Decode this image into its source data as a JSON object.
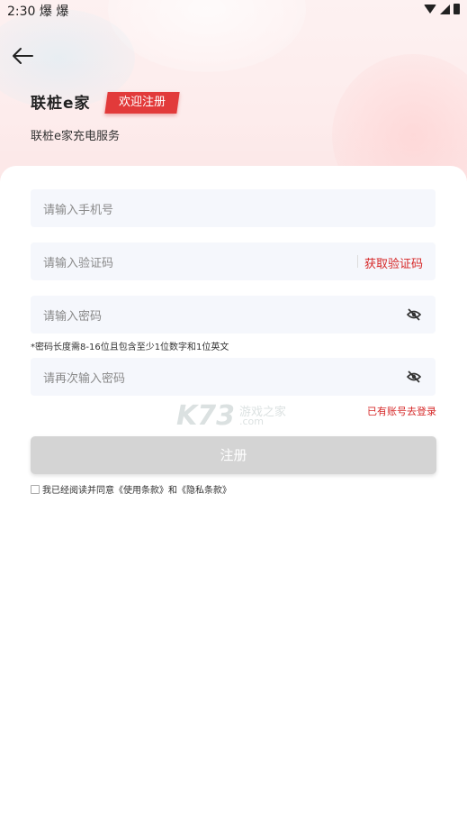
{
  "status_bar": {
    "time": "2:30",
    "extra_icons": "爆 爆"
  },
  "header": {
    "logo": "联桩e家",
    "welcome_badge": "欢迎注册",
    "subtitle": "联桩e家充电服务"
  },
  "form": {
    "phone_placeholder": "请输入手机号",
    "code_placeholder": "请输入验证码",
    "get_code_label": "获取验证码",
    "password_placeholder": "请输入密码",
    "password_hint": "*密码长度需8-16位且包含至少1位数字和1位英文",
    "confirm_password_placeholder": "请再次输入密码",
    "login_link": "已有账号去登录",
    "submit_label": "注册",
    "agreement_text": "我已经阅读并同意《使用条款》和《隐私条款》"
  },
  "watermark": {
    "brand": "K73",
    "cn": "游戏之家",
    "domain": ".com"
  },
  "colors": {
    "accent": "#d62828",
    "badge": "#e23a3a",
    "field_bg": "#f5f7fc",
    "button_disabled": "#d4d4d4"
  }
}
